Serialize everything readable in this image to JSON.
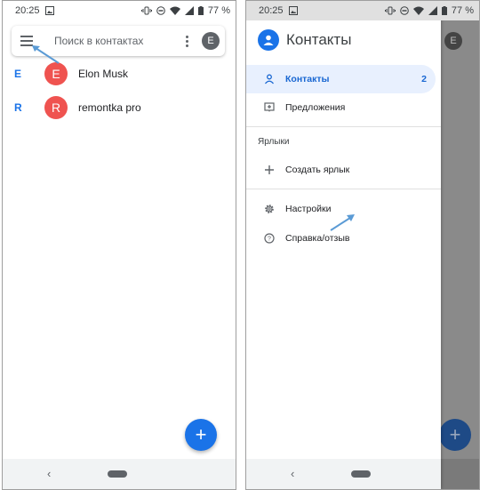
{
  "left_screen": {
    "status": {
      "time": "20:25",
      "battery": "77 %"
    },
    "search": {
      "placeholder": "Поиск в контактах",
      "account_initial": "E"
    },
    "contacts": [
      {
        "section_letter": "E",
        "initial": "E",
        "name": "Elon Musk"
      },
      {
        "section_letter": "R",
        "initial": "R",
        "name": "remontka pro"
      }
    ],
    "fab": {
      "label": "+"
    },
    "nav": {
      "back": "‹"
    }
  },
  "right_screen": {
    "status": {
      "time": "20:25",
      "battery": "77 %"
    },
    "app_title": "Контакты",
    "menu": {
      "contacts_label": "Контакты",
      "contacts_count": "2",
      "suggestions_label": "Предложения",
      "labels_heading": "Ярлыки",
      "create_label": "Создать ярлык",
      "settings_label": "Настройки",
      "help_label": "Справка/отзыв"
    },
    "background": {
      "account_initial": "E",
      "fab_label": "+"
    },
    "nav": {
      "back": "‹"
    }
  },
  "colors": {
    "accent": "#1a73e8",
    "avatar_red": "#ef5350",
    "active_item_bg": "#e8f0fe",
    "annotation_arrow": "#5b9bd5"
  },
  "icons": [
    "notification-image-icon",
    "vibrate-icon",
    "dnd-icon",
    "wifi-icon",
    "signal-icon",
    "battery-icon",
    "hamburger-menu-icon",
    "more-vert-icon",
    "contacts-app-icon",
    "person-icon",
    "suggestion-icon",
    "plus-icon",
    "gear-icon",
    "help-icon",
    "back-icon",
    "home-pill-icon"
  ]
}
